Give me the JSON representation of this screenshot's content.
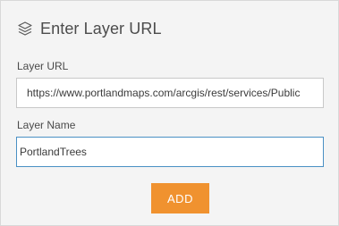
{
  "header": {
    "icon": "layers-icon",
    "title": "Enter Layer URL"
  },
  "form": {
    "layer_url": {
      "label": "Layer URL",
      "value": "https://www.portlandmaps.com/arcgis/rest/services/Public"
    },
    "layer_name": {
      "label": "Layer Name",
      "value": "PortlandTrees"
    },
    "add_button_label": "ADD"
  },
  "colors": {
    "accent": "#f0922f",
    "focus_border": "#4a90c4",
    "panel_bg": "#f4f4f4"
  }
}
